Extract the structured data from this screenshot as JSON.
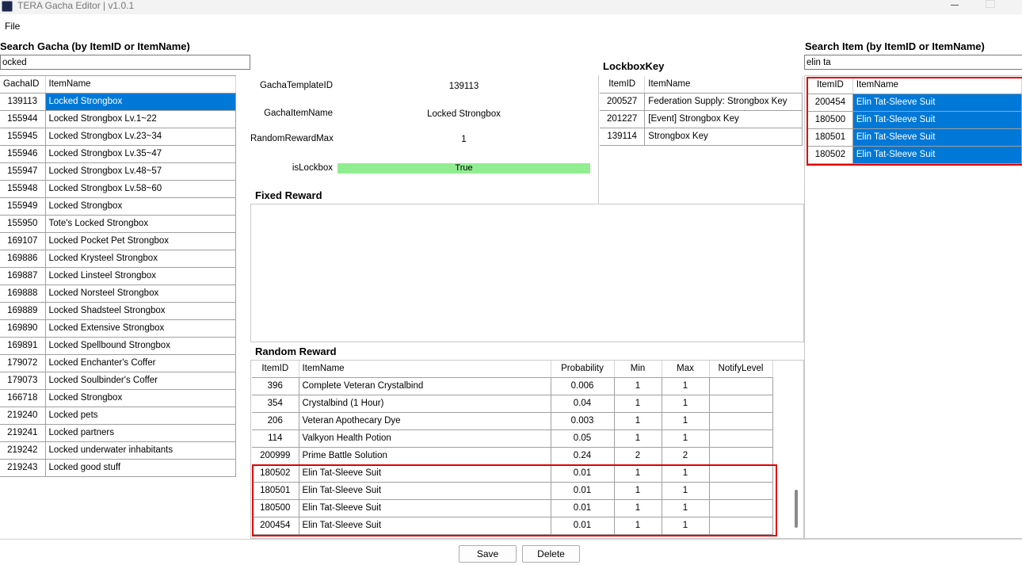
{
  "window": {
    "title": "TERA Gacha Editor | v1.0.1"
  },
  "menu": {
    "file": "File"
  },
  "gacha_search": {
    "label": "Search Gacha (by ItemID or ItemName)",
    "value": "ocked",
    "columns": [
      "GachaID",
      "ItemName"
    ],
    "rows": [
      [
        "139113",
        "Locked Strongbox"
      ],
      [
        "155944",
        "Locked Strongbox Lv.1~22"
      ],
      [
        "155945",
        "Locked Strongbox Lv.23~34"
      ],
      [
        "155946",
        "Locked Strongbox Lv.35~47"
      ],
      [
        "155947",
        "Locked Strongbox Lv.48~57"
      ],
      [
        "155948",
        "Locked Strongbox Lv.58~60"
      ],
      [
        "155949",
        "Locked Strongbox"
      ],
      [
        "155950",
        "Tote's Locked Strongbox"
      ],
      [
        "169107",
        "Locked Pocket Pet Strongbox"
      ],
      [
        "169886",
        "Locked Krysteel Strongbox"
      ],
      [
        "169887",
        "Locked Linsteel Strongbox"
      ],
      [
        "169888",
        "Locked Norsteel Strongbox"
      ],
      [
        "169889",
        "Locked Shadsteel Strongbox"
      ],
      [
        "169890",
        "Locked Extensive Strongbox"
      ],
      [
        "169891",
        "Locked Spellbound Strongbox"
      ],
      [
        "179072",
        "Locked Enchanter's Coffer"
      ],
      [
        "179073",
        "Locked Soulbinder's Coffer"
      ],
      [
        "166718",
        "Locked Strongbox"
      ],
      [
        "219240",
        "Locked pets"
      ],
      [
        "219241",
        "Locked partners"
      ],
      [
        "219242",
        "Locked underwater inhabitants"
      ],
      [
        "219243",
        "Locked good stuff"
      ]
    ]
  },
  "details": {
    "gacha_template_id_label": "GachaTemplateID",
    "gacha_template_id": "139113",
    "gacha_item_name_label": "GachaItemName",
    "gacha_item_name": "Locked Strongbox",
    "random_reward_max_label": "RandomRewardMax",
    "random_reward_max": "1",
    "is_lockbox_label": "isLockbox",
    "is_lockbox": "True"
  },
  "lockbox_key": {
    "label": "LockboxKey",
    "columns": [
      "ItemID",
      "ItemName"
    ],
    "rows": [
      [
        "200527",
        "Federation Supply: Strongbox Key"
      ],
      [
        "201227",
        "[Event] Strongbox Key"
      ],
      [
        "139114",
        "Strongbox Key"
      ]
    ]
  },
  "fixed_reward": {
    "label": "Fixed Reward"
  },
  "random_reward": {
    "label": "Random Reward",
    "columns": [
      "ItemID",
      "ItemName",
      "Probability",
      "Min",
      "Max",
      "NotifyLevel"
    ],
    "rows": [
      [
        "396",
        "Complete Veteran Crystalbind",
        "0.006",
        "1",
        "1",
        ""
      ],
      [
        "354",
        "Crystalbind (1 Hour)",
        "0.04",
        "1",
        "1",
        ""
      ],
      [
        "206",
        "Veteran Apothecary Dye",
        "0.003",
        "1",
        "1",
        ""
      ],
      [
        "114",
        "Valkyon Health Potion",
        "0.05",
        "1",
        "1",
        ""
      ],
      [
        "200999",
        "Prime Battle Solution",
        "0.24",
        "2",
        "2",
        ""
      ],
      [
        "180502",
        "Elin Tat-Sleeve Suit",
        "0.01",
        "1",
        "1",
        ""
      ],
      [
        "180501",
        "Elin Tat-Sleeve Suit",
        "0.01",
        "1",
        "1",
        ""
      ],
      [
        "180500",
        "Elin Tat-Sleeve Suit",
        "0.01",
        "1",
        "1",
        ""
      ],
      [
        "200454",
        "Elin Tat-Sleeve Suit",
        "0.01",
        "1",
        "1",
        ""
      ]
    ]
  },
  "item_search": {
    "label": "Search Item (by ItemID or ItemName)",
    "value": "elin ta",
    "columns": [
      "ItemID",
      "ItemName"
    ],
    "rows": [
      [
        "200454",
        "Elin Tat-Sleeve Suit"
      ],
      [
        "180500",
        "Elin Tat-Sleeve Suit"
      ],
      [
        "180501",
        "Elin Tat-Sleeve Suit"
      ],
      [
        "180502",
        "Elin Tat-Sleeve Suit"
      ]
    ]
  },
  "buttons": {
    "save": "Save",
    "delete": "Delete"
  },
  "colors": {
    "selection": "#0078d7",
    "highlight": "#e00000",
    "lockbox_true": "#90ee90"
  },
  "icons": {
    "app": "app-icon",
    "minimize": "minimize-icon",
    "maximize": "maximize-icon"
  }
}
